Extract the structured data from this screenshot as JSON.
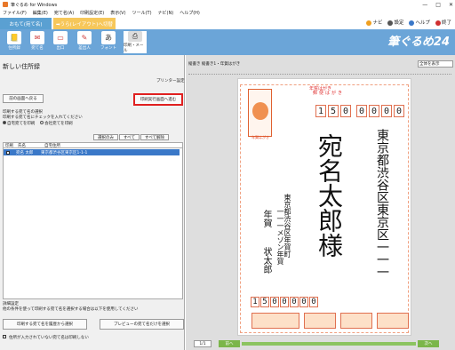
{
  "window": {
    "title": "筆ぐるめ for Windows"
  },
  "menu": [
    "ファイル(F)",
    "編集(E)",
    "宛て名(A)",
    "印刷設定(E)",
    "表示(V)",
    "ツール(T)",
    "ナビ(N)",
    "ヘルプ(H)"
  ],
  "topnav": {
    "navi": "ナビ",
    "settings": "設定",
    "help": "ヘルプ",
    "exit": "終了"
  },
  "tabs": {
    "front": "おもて(宛て名)",
    "back": "➡うら(レイアウト)へ切替"
  },
  "ribbon": [
    "住所録",
    "宛て名",
    "出口",
    "差出人",
    "フォント",
    "印刷・メール"
  ],
  "brand": "筆ぐるめ24",
  "left": {
    "title": "新しい住所録",
    "print_settings": "プリンター設定",
    "back_button": "前の画面へ戻る",
    "print_button": "印刷実行画面へ進む",
    "select_heading": "印刷する宛て名の選択",
    "select_hint": "印刷する宛て名にチェックを入れてください",
    "radio_home": "自宅宛てを印刷",
    "radio_company": "会社宛てを印刷",
    "sel_buttons": [
      "選択のみ",
      "すべて",
      "すべて解除"
    ],
    "columns": [
      "印刷",
      "氏名",
      "自宅住所"
    ],
    "rows": [
      {
        "name": "宛名 太郎",
        "address": "東京都渋谷区東京区1-1-1"
      }
    ],
    "detail_heading": "詳細設定",
    "detail_hint": "他の条件を使って印刷する宛て名を選択する場合は以下を使用してください",
    "history_button": "印刷する宛て名を履歴から選択",
    "preview_button": "プレビューの宛て名だけを選択",
    "exclude_check": "住所が入力されていない宛て名は印刷しない"
  },
  "right": {
    "label": "縦書き 縦書き1・年賀はがき",
    "zoom": "全体を表示",
    "postcard": {
      "red1": "年賀はがき",
      "red2": "郵便はがき",
      "zip": [
        "1",
        "5",
        "0",
        "0",
        "0",
        "0",
        "0"
      ],
      "addr1": "東京都渋谷区東京区一一一",
      "name": "宛名太郎様",
      "sender_addr": "東京都渋谷区年賀町",
      "sender_addr2": "一一一メゾン年賀",
      "sender_label": "年賀",
      "sender_name": "状太郎",
      "send_zip": [
        "1",
        "5",
        "0",
        "0",
        "0",
        "0",
        "0"
      ]
    },
    "page": "1/1",
    "prev": "前へ",
    "next": "次へ"
  },
  "colors": {
    "ribbon": "#6ba5d8",
    "accent": "#f6c75a",
    "highlight": "#e02020"
  }
}
